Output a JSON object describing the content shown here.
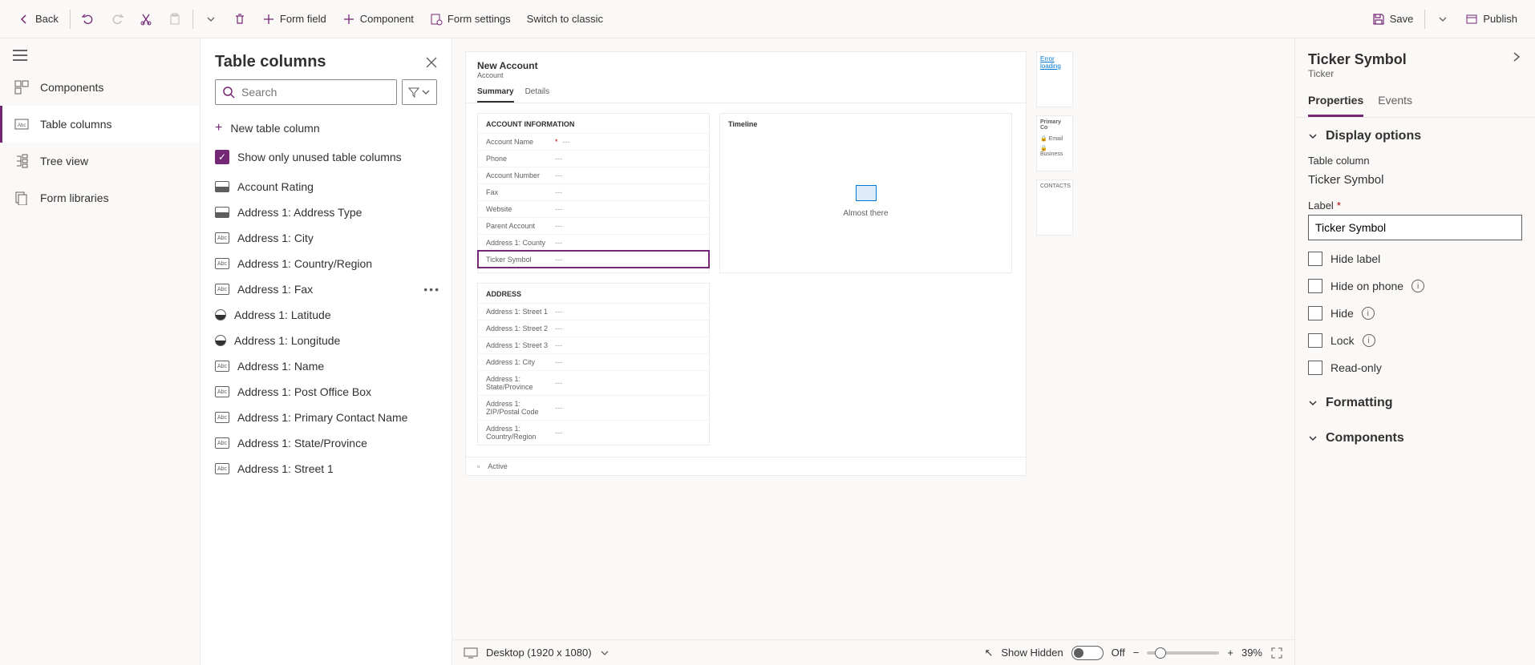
{
  "toolbar": {
    "back": "Back",
    "form_field": "Form field",
    "component": "Component",
    "form_settings": "Form settings",
    "switch_classic": "Switch to classic",
    "save": "Save",
    "publish": "Publish"
  },
  "leftnav": {
    "components": "Components",
    "table_columns": "Table columns",
    "tree_view": "Tree view",
    "form_libraries": "Form libraries"
  },
  "colpanel": {
    "title": "Table columns",
    "search_placeholder": "Search",
    "new_column": "New table column",
    "show_unused": "Show only unused table columns",
    "items": [
      {
        "label": "Account Rating",
        "type": "opt"
      },
      {
        "label": "Address 1: Address Type",
        "type": "opt"
      },
      {
        "label": "Address 1: City",
        "type": "abc"
      },
      {
        "label": "Address 1: Country/Region",
        "type": "abc"
      },
      {
        "label": "Address 1: Fax",
        "type": "abc",
        "hover": true
      },
      {
        "label": "Address 1: Latitude",
        "type": "float"
      },
      {
        "label": "Address 1: Longitude",
        "type": "float"
      },
      {
        "label": "Address 1: Name",
        "type": "abc"
      },
      {
        "label": "Address 1: Post Office Box",
        "type": "abc"
      },
      {
        "label": "Address 1: Primary Contact Name",
        "type": "abc"
      },
      {
        "label": "Address 1: State/Province",
        "type": "abc"
      },
      {
        "label": "Address 1: Street 1",
        "type": "abc"
      }
    ]
  },
  "canvas": {
    "form_title": "New Account",
    "form_entity": "Account",
    "tabs": [
      "Summary",
      "Details"
    ],
    "sec1_title": "ACCOUNT INFORMATION",
    "sec1_fields": [
      {
        "label": "Account Name",
        "req": true,
        "val": "---"
      },
      {
        "label": "Phone",
        "val": "---"
      },
      {
        "label": "Account Number",
        "val": "---"
      },
      {
        "label": "Fax",
        "val": "---"
      },
      {
        "label": "Website",
        "val": "---"
      },
      {
        "label": "Parent Account",
        "val": "---"
      },
      {
        "label": "Address 1: County",
        "val": "---"
      },
      {
        "label": "Ticker Symbol",
        "val": "---",
        "selected": true
      }
    ],
    "sec2_title": "Timeline",
    "timeline_msg": "Almost there",
    "sec3_title": "ADDRESS",
    "sec3_fields": [
      {
        "label": "Address 1: Street 1",
        "val": "---"
      },
      {
        "label": "Address 1: Street 2",
        "val": "---"
      },
      {
        "label": "Address 1: Street 3",
        "val": "---"
      },
      {
        "label": "Address 1: City",
        "val": "---"
      },
      {
        "label": "Address 1: State/Province",
        "val": "---"
      },
      {
        "label": "Address 1: ZIP/Postal Code",
        "val": "---"
      },
      {
        "label": "Address 1: Country/Region",
        "val": "---"
      }
    ],
    "error_loading": "Error loading",
    "mini_primary": "Primary Co",
    "mini_email": "Email",
    "mini_business": "Business",
    "mini_contacts": "CONTACTS",
    "status_active": "Active"
  },
  "footer": {
    "viewport": "Desktop (1920 x 1080)",
    "show_hidden": "Show Hidden",
    "toggle_state": "Off",
    "zoom": "39%"
  },
  "prop": {
    "title": "Ticker Symbol",
    "subtitle": "Ticker",
    "tab_properties": "Properties",
    "tab_events": "Events",
    "sec_display": "Display options",
    "table_column_label": "Table column",
    "table_column_value": "Ticker Symbol",
    "label_label": "Label",
    "label_value": "Ticker Symbol",
    "hide_label": "Hide label",
    "hide_phone": "Hide on phone",
    "hide": "Hide",
    "lock": "Lock",
    "readonly": "Read-only",
    "sec_formatting": "Formatting",
    "sec_components": "Components"
  }
}
